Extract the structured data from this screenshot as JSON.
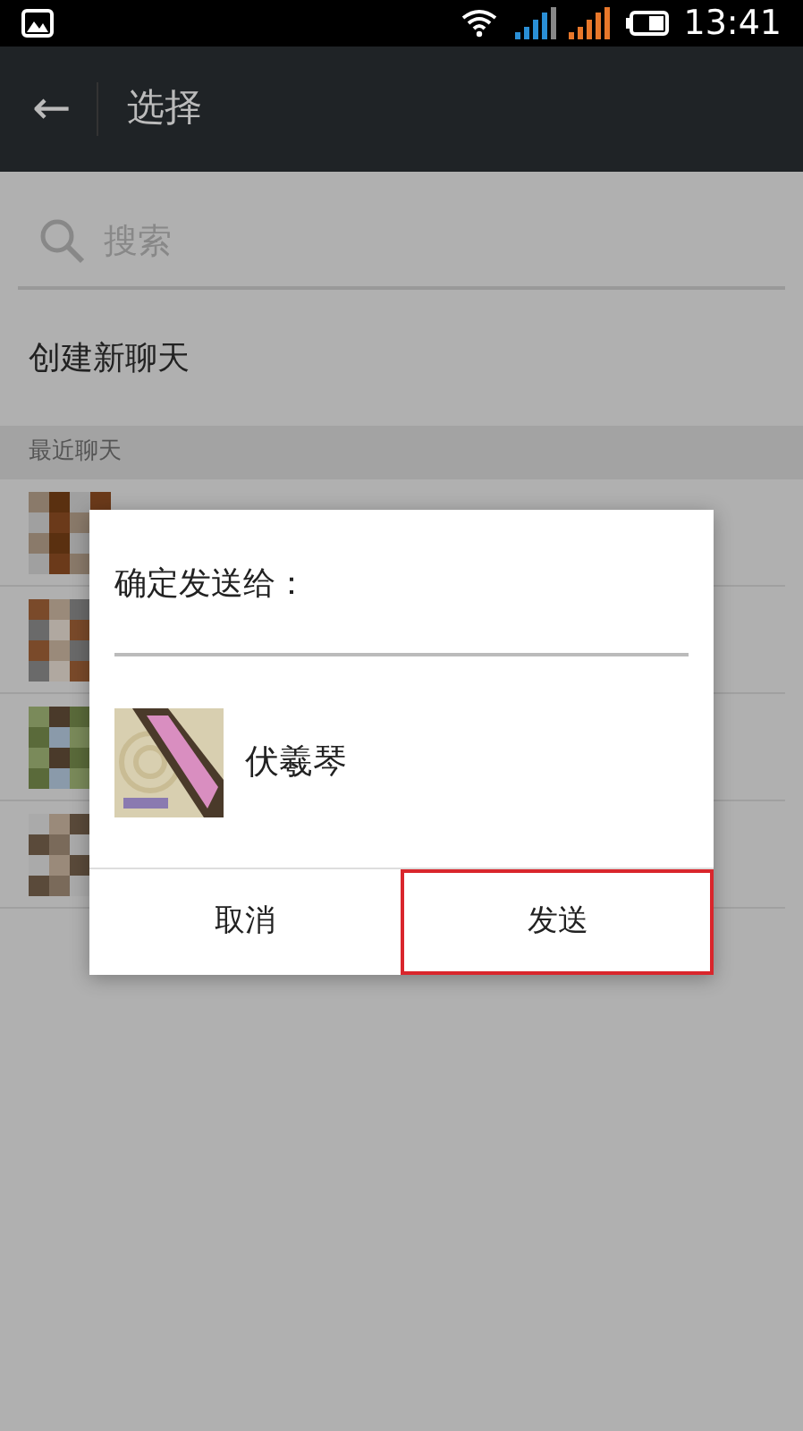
{
  "status_bar": {
    "time": "13:41"
  },
  "app_bar": {
    "back": "←",
    "title": "选择"
  },
  "search": {
    "placeholder": "搜索"
  },
  "new_chat": "创建新聊天",
  "section_header": "最近聊天",
  "dialog": {
    "title": "确定发送给：",
    "recipient": {
      "name": "伏羲琴"
    },
    "buttons": [
      {
        "label": "取消",
        "selected": false
      },
      {
        "label": "发送",
        "selected": true
      }
    ]
  }
}
